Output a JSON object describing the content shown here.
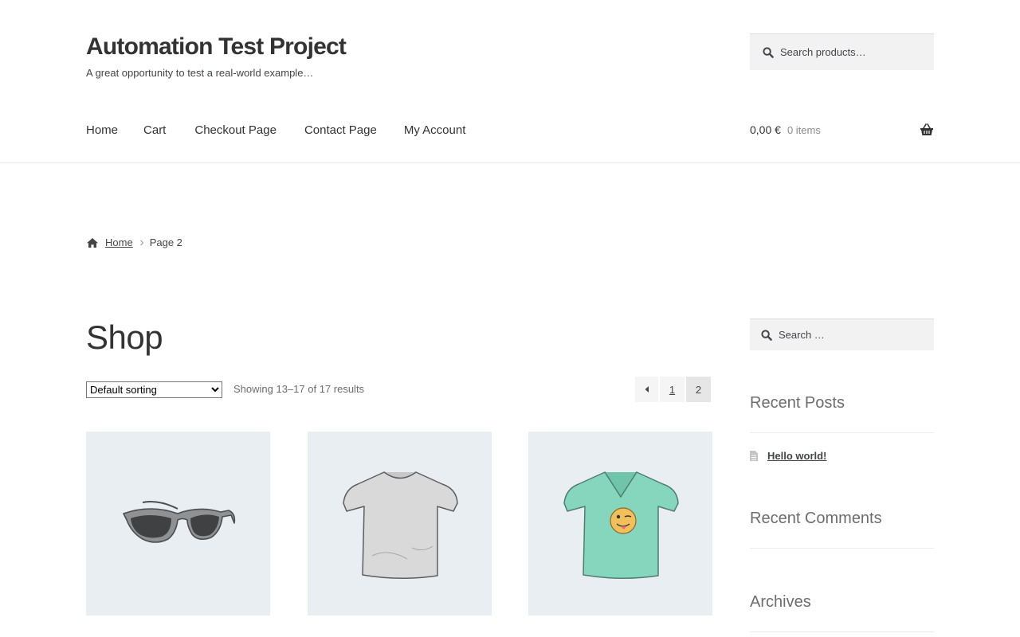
{
  "site": {
    "title": "Automation Test Project",
    "tagline": "A great opportunity to test a real-world example…"
  },
  "header_search": {
    "placeholder": "Search products…"
  },
  "nav": {
    "items": [
      {
        "label": "Home"
      },
      {
        "label": "Cart"
      },
      {
        "label": "Checkout Page"
      },
      {
        "label": "Contact Page"
      },
      {
        "label": "My Account"
      }
    ]
  },
  "cart": {
    "amount": "0,00 €",
    "count": "0 items",
    "icon": "basket-icon"
  },
  "breadcrumb": {
    "home": "Home",
    "current": "Page 2",
    "icon": "home-icon"
  },
  "page": {
    "title": "Shop"
  },
  "toolbar": {
    "sorting_selected": "Default sorting",
    "result_count": "Showing 13–17 of 17 results"
  },
  "pagination": {
    "pages": [
      "1",
      "2"
    ],
    "current": "2"
  },
  "products": [
    {
      "image": "sunglasses"
    },
    {
      "image": "grey-t-shirt"
    },
    {
      "image": "green-v-neck-t-shirt-with-emoji"
    }
  ],
  "sidebar": {
    "search_placeholder": "Search …",
    "recent_posts_title": "Recent Posts",
    "recent_posts": [
      {
        "label": "Hello world!"
      }
    ],
    "recent_comments_title": "Recent Comments",
    "archives_title": "Archives"
  },
  "colors": {
    "text": "#43454b",
    "heading": "#333333",
    "muted": "#6d6d6d",
    "product_bg": "#e9eef2",
    "field_bg": "#f2f2f2"
  }
}
